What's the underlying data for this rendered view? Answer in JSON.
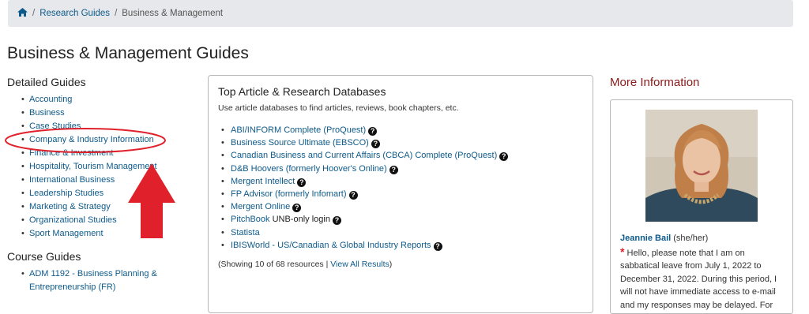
{
  "breadcrumb": {
    "home_icon": "home-icon",
    "separator": "/",
    "items": [
      {
        "label": "Research Guides"
      },
      {
        "label": "Business & Management"
      }
    ]
  },
  "page_title": "Business & Management Guides",
  "detailed_guides": {
    "heading": "Detailed Guides",
    "items": [
      "Accounting",
      "Business",
      "Case Studies",
      "Company & Industry Information",
      "Finance & Investment",
      "Hospitality, Tourism Management",
      "International Business",
      "Leadership Studies",
      "Marketing & Strategy",
      "Organizational Studies",
      "Sport Management"
    ]
  },
  "course_guides": {
    "heading": "Course Guides",
    "items": [
      "ADM 1192 - Business Planning & Entrepreneurship (FR)"
    ]
  },
  "databases": {
    "heading": "Top Article & Research Databases",
    "description": "Use article databases to find articles, reviews, book chapters, etc.",
    "items": [
      {
        "label": "ABI/INFORM Complete (ProQuest)",
        "suffix": ""
      },
      {
        "label": "Business Source Ultimate (EBSCO)",
        "suffix": ""
      },
      {
        "label": "Canadian Business and Current Affairs (CBCA) Complete (ProQuest)",
        "suffix": ""
      },
      {
        "label": "D&B Hoovers (formerly Hoover's Online)",
        "suffix": ""
      },
      {
        "label": "Mergent Intellect",
        "suffix": ""
      },
      {
        "label": "FP Advisor (formerly Infomart)",
        "suffix": ""
      },
      {
        "label": "Mergent Online",
        "suffix": ""
      },
      {
        "label": "PitchBook",
        "suffix": " UNB-only login"
      },
      {
        "label": "Statista",
        "suffix": ""
      },
      {
        "label": "IBISWorld - US/Canadian & Global Industry Reports",
        "suffix": ""
      }
    ],
    "info_icon_glyph": "?",
    "showing_text": "(Showing 10 of 68 resources | ",
    "view_all": "View All Results",
    "showing_close": ")"
  },
  "more_info": {
    "heading": "More Information",
    "profile": {
      "name": "Jeannie Bail",
      "pronouns": " (she/her)",
      "asterisk": "*",
      "note": " Hello, please note that I am on sabbatical leave from July 1, 2022 to December 31, 2022. During this period, I will not have immediate access to e-mail and my responses may be delayed. For"
    }
  },
  "colors": {
    "link": "#0e5a8a",
    "accent_heading": "#8b1a1a",
    "breadcrumb_bg": "#e6e8eb",
    "annotation_red": "#e0202a"
  }
}
